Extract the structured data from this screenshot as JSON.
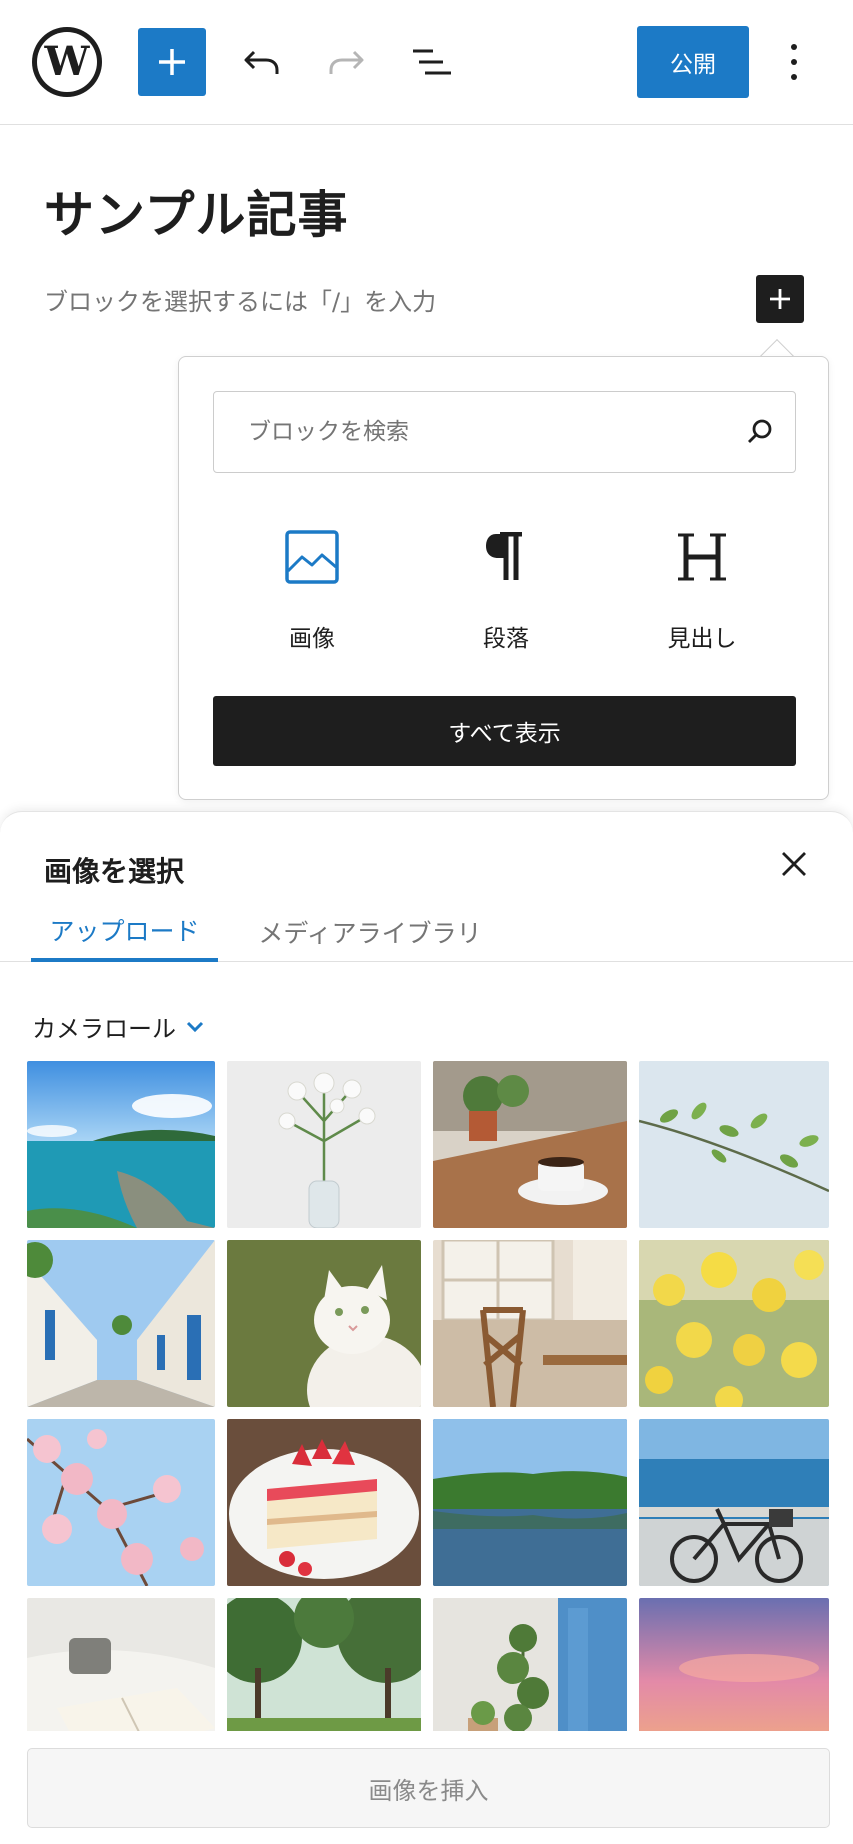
{
  "toolbar": {
    "logo_letter": "W",
    "publish_label": "公開",
    "icons": [
      "wordpress-logo",
      "plus-icon",
      "undo-icon",
      "redo-icon",
      "list-view-icon",
      "more-vertical-icon"
    ]
  },
  "editor": {
    "post_title": "サンプル記事",
    "block_placeholder": "ブロックを選択するには「/」を入力"
  },
  "inserter": {
    "search_placeholder": "ブロックを検索",
    "blocks": [
      {
        "label": "画像",
        "icon": "image-icon"
      },
      {
        "label": "段落",
        "icon": "paragraph-icon"
      },
      {
        "label": "見出し",
        "icon": "heading-icon"
      }
    ],
    "show_all_label": "すべて表示"
  },
  "media_sheet": {
    "title": "画像を選択",
    "tabs": [
      {
        "label": "アップロード",
        "active": true
      },
      {
        "label": "メディアライブラリ",
        "active": false
      }
    ],
    "album_label": "カメラロール",
    "photos": [
      "seaside-coast",
      "white-flowers-vase",
      "coffee-on-table",
      "green-branch",
      "white-alley-blue-doors",
      "white-cat",
      "wooden-chair-window",
      "yellow-rapeseed-flowers",
      "cherry-blossoms",
      "strawberry-cake",
      "lake-forest",
      "bicycle-by-sea",
      "bed-book-mug",
      "park-trees",
      "plant-blue-door",
      "sunset-sky"
    ],
    "insert_label": "画像を挿入"
  },
  "colors": {
    "accent": "#1c7ac6",
    "dark": "#1e1e1e",
    "muted_text": "#757575"
  }
}
